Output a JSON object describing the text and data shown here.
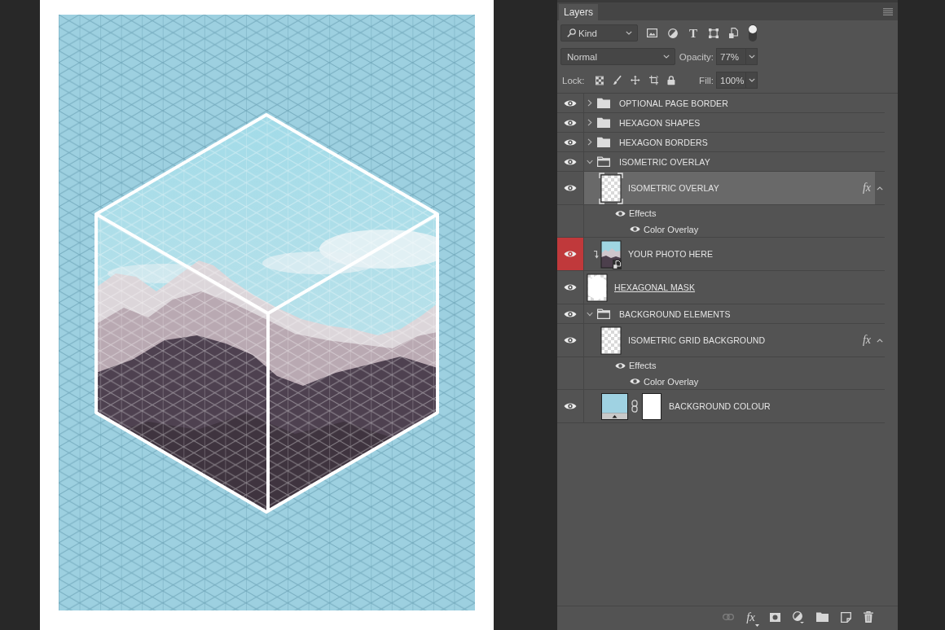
{
  "tabs": [
    {
      "label": "Layers",
      "selected": true
    }
  ],
  "filter": {
    "kind": "Kind",
    "type_glyph": "T",
    "enabled": true
  },
  "blend": {
    "mode": "Normal",
    "opacity_label": "Opacity:",
    "opacity": "77%"
  },
  "lock": {
    "label": "Lock:",
    "fill_label": "Fill:",
    "fill": "100%"
  },
  "layers": [
    {
      "kind": "group",
      "name": "OPTIONAL PAGE BORDER",
      "visible": true,
      "expanded": false,
      "selected": false,
      "clipped": false,
      "clipping_base": false
    },
    {
      "kind": "group",
      "name": "HEXAGON SHAPES",
      "visible": true,
      "expanded": false,
      "selected": false,
      "clipped": false,
      "clipping_base": false
    },
    {
      "kind": "group",
      "name": "HEXAGON BORDERS",
      "visible": true,
      "expanded": false,
      "selected": false,
      "clipped": false,
      "clipping_base": false
    },
    {
      "kind": "group",
      "name": "ISOMETRIC OVERLAY",
      "visible": true,
      "expanded": true,
      "selected": false,
      "clipped": false,
      "clipping_base": false,
      "children": [
        {
          "kind": "layer",
          "name": "ISOMETRIC OVERLAY",
          "visible": true,
          "selected": true,
          "clipped": false,
          "clipping_base": false,
          "effects": {
            "badge": "fx",
            "expanded": true,
            "label": "Effects",
            "visible": true,
            "items": [
              {
                "name": "Color Overlay",
                "visible": true
              }
            ]
          }
        }
      ]
    },
    {
      "kind": "smart-object",
      "name": "YOUR PHOTO HERE",
      "visible": true,
      "selected": false,
      "clipped": true,
      "clipping_base": false,
      "color": "#c0393b"
    },
    {
      "kind": "shape",
      "name": "HEXAGONAL MASK",
      "visible": true,
      "selected": false,
      "clipped": false,
      "clipping_base": true
    },
    {
      "kind": "group",
      "name": "BACKGROUND ELEMENTS",
      "visible": true,
      "expanded": true,
      "selected": false,
      "clipped": false,
      "clipping_base": false,
      "children": [
        {
          "kind": "layer",
          "name": "ISOMETRIC GRID BACKGROUND",
          "visible": true,
          "selected": false,
          "clipped": false,
          "clipping_base": false,
          "effects": {
            "badge": "fx",
            "expanded": true,
            "label": "Effects",
            "visible": true,
            "items": [
              {
                "name": "Color Overlay",
                "visible": true
              }
            ]
          }
        },
        {
          "kind": "fill",
          "name": "BACKGROUND COLOUR",
          "visible": true,
          "selected": false,
          "clipped": false,
          "clipping_base": false
        }
      ]
    }
  ],
  "footer": {
    "fx": "fx"
  }
}
